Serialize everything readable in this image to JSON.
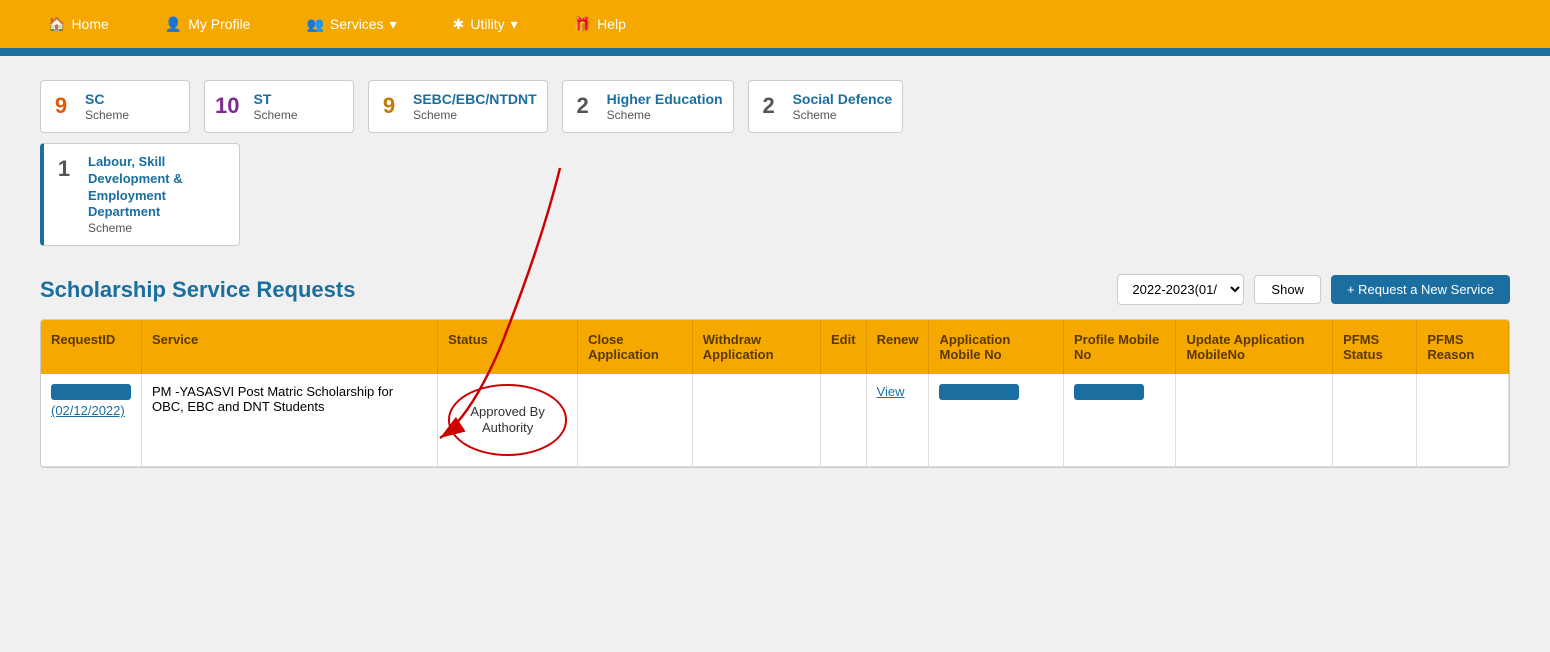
{
  "nav": {
    "home": "Home",
    "myProfile": "My Profile",
    "services": "Services",
    "utility": "Utility",
    "help": "Help"
  },
  "schemes": [
    {
      "id": "sc",
      "number": "9",
      "title": "SC",
      "subtitle": "Scheme"
    },
    {
      "id": "st",
      "number": "10",
      "title": "ST",
      "subtitle": "Scheme"
    },
    {
      "id": "sebc",
      "number": "9",
      "title": "SEBC/EBC/NTDNT",
      "subtitle": "Scheme"
    },
    {
      "id": "higher",
      "number": "2",
      "title": "Higher Education",
      "subtitle": "Scheme"
    },
    {
      "id": "social",
      "number": "2",
      "title": "Social Defence",
      "subtitle": "Scheme"
    }
  ],
  "labourScheme": {
    "number": "1",
    "title": "Labour, Skill Development & Employment Department",
    "subtitle": "Scheme"
  },
  "sectionTitle": "Scholarship Service Requests",
  "yearSelect": "2022-2023(01/",
  "showBtn": "Show",
  "newServiceBtn": "+ Request a New Service",
  "tableHeaders": [
    "RequestID",
    "Service",
    "Status",
    "Close Application",
    "Withdraw Application",
    "Edit",
    "Renew",
    "Application Mobile No",
    "Profile Mobile No",
    "Update Application MobileNo",
    "PFMS Status",
    "PFMS Reason"
  ],
  "tableRow": {
    "requestId": "(02/12/2022)",
    "service": "PM -YASASVI Post Matric Scholarship for OBC, EBC and DNT Students",
    "status": "Approved By Authority",
    "closeApp": "",
    "withdrawApp": "",
    "edit": "",
    "renew": "View",
    "appMobile": "",
    "profileMobile": "",
    "updateMobile": "",
    "pfmsStatus": "",
    "pfmsReason": ""
  }
}
